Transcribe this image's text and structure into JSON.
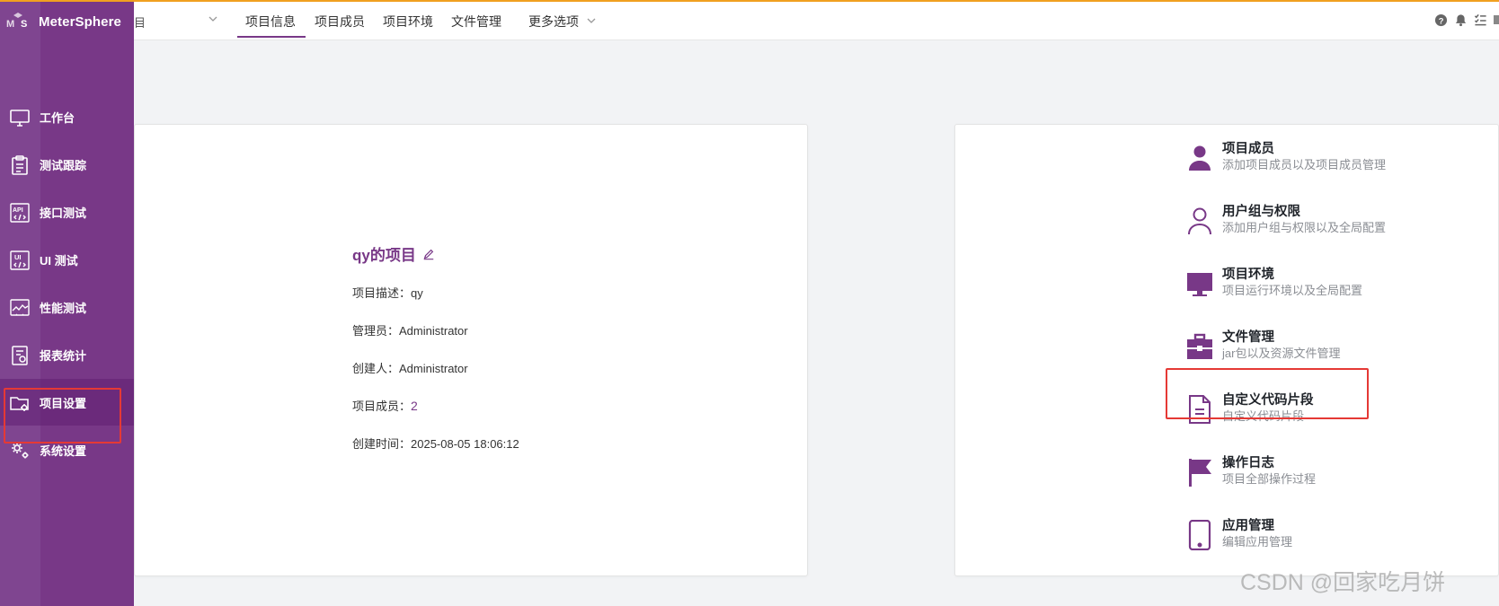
{
  "app": {
    "logo_text": "MeterSphere"
  },
  "colors": {
    "brand": "#783887",
    "accent_line": "#f0a020",
    "highlight": "#e53935"
  },
  "sidebar": {
    "items": [
      {
        "label": "工作台",
        "icon": "monitor-icon"
      },
      {
        "label": "测试跟踪",
        "icon": "clipboard-icon"
      },
      {
        "label": "接口测试",
        "icon": "api-icon"
      },
      {
        "label": "UI 测试",
        "icon": "ui-test-icon"
      },
      {
        "label": "性能测试",
        "icon": "performance-chart-icon"
      },
      {
        "label": "报表统计",
        "icon": "report-icon"
      },
      {
        "label": "项目设置",
        "icon": "folder-gear-icon",
        "active": true
      },
      {
        "label": "系统设置",
        "icon": "gears-icon"
      }
    ]
  },
  "topbar": {
    "project_select_value": "目",
    "tabs": [
      {
        "label": "项目信息",
        "active": true
      },
      {
        "label": "项目成员"
      },
      {
        "label": "项目环境"
      },
      {
        "label": "文件管理"
      },
      {
        "label": "更多选项"
      }
    ],
    "right_icons": [
      "help-icon",
      "bell-icon",
      "task-list-icon"
    ]
  },
  "project": {
    "name": "qy的项目",
    "description_label": "项目描述：",
    "description_value": "qy",
    "admin_label": "管理员：",
    "admin_value": "Administrator",
    "creator_label": "创建人：",
    "creator_value": "Administrator",
    "members_label": "项目成员：",
    "members_value": "2",
    "created_time_label": "创建时间：",
    "created_time_value": "2025-08-05 18:06:12"
  },
  "settings_menu": [
    {
      "title": "项目成员",
      "desc": "添加项目成员以及项目成员管理",
      "icon": "user-icon"
    },
    {
      "title": "用户组与权限",
      "desc": "添加用户组与权限以及全局配置",
      "icon": "user-outline-icon"
    },
    {
      "title": "项目环境",
      "desc": "项目运行环境以及全局配置",
      "icon": "monitor-icon"
    },
    {
      "title": "文件管理",
      "desc": "jar包以及资源文件管理",
      "icon": "briefcase-icon"
    },
    {
      "title": "自定义代码片段",
      "desc": "自定义代码片段",
      "icon": "document-icon"
    },
    {
      "title": "操作日志",
      "desc": "项目全部操作过程",
      "icon": "flag-icon"
    },
    {
      "title": "应用管理",
      "desc": "编辑应用管理",
      "icon": "tablet-icon"
    }
  ],
  "watermark": "CSDN @回家吃月饼"
}
